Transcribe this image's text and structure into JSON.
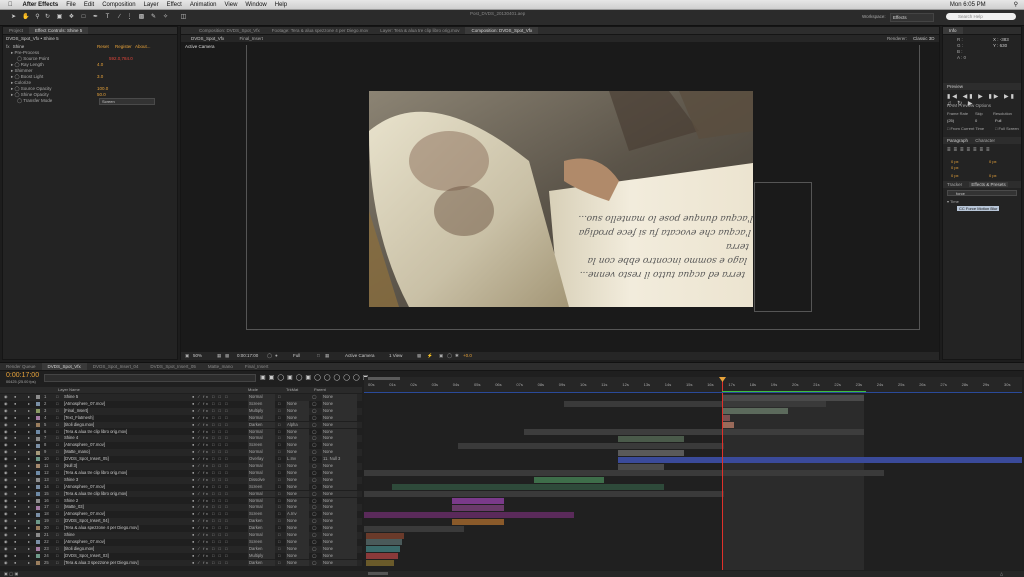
{
  "menubar": {
    "app_name": "After Effects",
    "items": [
      "File",
      "Edit",
      "Composition",
      "Layer",
      "Effect",
      "Animation",
      "View",
      "Window",
      "Help"
    ],
    "clock": "Mon 6:05 PM"
  },
  "toolbar": {
    "workspace_label": "Workspace:",
    "workspace_value": "Effects",
    "search_placeholder": "Search Help",
    "window_title": "Post_DVDS_20130401.aep"
  },
  "left_panel": {
    "tabs": [
      "Project",
      "Effect Controls: Shine 5"
    ],
    "header": "DVDS_Spot_Vfx • Shine 5",
    "effect": {
      "name": "Shine",
      "reset": "Reset",
      "register": "Register",
      "about": "About...",
      "props": [
        {
          "label": "Pre-Process",
          "value": ""
        },
        {
          "label": "Source Point",
          "value": "592.0,784.0"
        },
        {
          "label": "Ray Length",
          "value": "4.0"
        },
        {
          "label": "Shimmer",
          "value": ""
        },
        {
          "label": "Boost Light",
          "value": "3.0"
        },
        {
          "label": "Colorize",
          "value": ""
        },
        {
          "label": "Source Opacity",
          "value": "100.0"
        },
        {
          "label": "Shine Opacity",
          "value": "50.0"
        },
        {
          "label": "Transfer Mode",
          "value": "Screen"
        }
      ]
    }
  },
  "viewer": {
    "tabs": [
      "Composition: DVDS_Spot_Vfx",
      "Footage: Tera & alua spezzone 4 per Diego.mov",
      "Layer: Tera & alua tre clip libro orig.mov",
      "Composition: DVDS_Spot_Vfx"
    ],
    "sub_tabs": [
      "DVDS_Spot_Vfx",
      "Final_Insert"
    ],
    "renderer_label": "Renderer:",
    "renderer_value": "Classic 3D",
    "camera_label": "Active Camera",
    "book_lines": [
      "terra ed acqua tutto il resto venne...",
      "lago e sommo incontro ebbe con la terra",
      "l'acqua che evocata fu si fece prodiga",
      "l'acqua dunque pose lo mantello suo..."
    ],
    "footer": {
      "zoom": "50%",
      "timecode": "0:00:17:00",
      "resolution": "Full",
      "camera": "Active Camera",
      "views": "1 View",
      "exposure": "+0.0"
    }
  },
  "right_panel": {
    "info_tab": "Info",
    "info": {
      "r": "R :",
      "g": "G :",
      "b": "B :",
      "a": "A : 0",
      "x": "X : -383",
      "y": "Y : 630"
    },
    "preview_tab": "Preview",
    "ram_preview": "RAM Preview Options",
    "frame_rate_label": "Frame Rate",
    "skip_label": "Skip",
    "resolution_label": "Resolution",
    "frame_rate": "(25)",
    "skip": "0",
    "resolution": "Full",
    "from_current": "From Current Time",
    "full_screen": "Full Screen",
    "paragraph_tab": "Paragraph",
    "character_tab": "Character",
    "para_values": [
      "0 px",
      "0 px",
      "0 px",
      "0 px",
      "0 px"
    ],
    "tracker_tab": "Tracker",
    "effects_tab": "Effects & Presets",
    "effects_search": "force",
    "effects_group": "Time",
    "effects_item": "CC Force Motion Blur"
  },
  "timeline": {
    "tabs": [
      "Render Queue",
      "DVDS_Spot_Vfx",
      "DVDS_Spot_Insert_04",
      "DVDS_Spot_Insert_05",
      "Matte_mano",
      "Final_Insert"
    ],
    "timecode": "0:00:17:00",
    "frame_info": "00425 (25.00 fps)",
    "col_layer": "Layer Name",
    "col_mode": "Mode",
    "col_trkmat": "TrkMat",
    "col_parent": "Parent",
    "ruler": [
      "00s",
      "01s",
      "02s",
      "03s",
      "04s",
      "05s",
      "06s",
      "07s",
      "08s",
      "09s",
      "10s",
      "11s",
      "12s",
      "13s",
      "14s",
      "15s",
      "16s",
      "17s",
      "18s",
      "19s",
      "20s",
      "21s",
      "22s",
      "23s",
      "24s",
      "25s",
      "26s",
      "27s",
      "28s",
      "29s",
      "30s"
    ],
    "layers": [
      {
        "num": "1",
        "name": "Shine 5",
        "mode": "Normal",
        "trk": "",
        "parent": "None"
      },
      {
        "num": "2",
        "name": "[Atmosphere_07.mov]",
        "mode": "Screen",
        "trk": "None",
        "parent": "None"
      },
      {
        "num": "3",
        "name": "[Final_Insert]",
        "mode": "Multiply",
        "trk": "None",
        "parent": "None"
      },
      {
        "num": "4",
        "name": "[Text_Flatmesh]",
        "mode": "Normal",
        "trk": "None",
        "parent": "None"
      },
      {
        "num": "5",
        "name": "[titoli diego.mov]",
        "mode": "Darken",
        "trk": "Alpha",
        "parent": "None"
      },
      {
        "num": "6",
        "name": "[Tera & alua tre clip libro orig.mov]",
        "mode": "Normal",
        "trk": "None",
        "parent": "None"
      },
      {
        "num": "7",
        "name": "Shine 4",
        "mode": "Normal",
        "trk": "None",
        "parent": "None"
      },
      {
        "num": "8",
        "name": "[Atmosphere_07.mov]",
        "mode": "Screen",
        "trk": "None",
        "parent": "None"
      },
      {
        "num": "9",
        "name": "[Matte_mano]",
        "mode": "Normal",
        "trk": "None",
        "parent": "None"
      },
      {
        "num": "10",
        "name": "[DVDS_Spot_Insert_05]",
        "mode": "Overlay",
        "trk": "L.Inv",
        "parent": "11. Null 3"
      },
      {
        "num": "11",
        "name": "[Null 3]",
        "mode": "Normal",
        "trk": "None",
        "parent": "None"
      },
      {
        "num": "12",
        "name": "[Tera & alua tre clip libro orig.mov]",
        "mode": "Normal",
        "trk": "None",
        "parent": "None"
      },
      {
        "num": "13",
        "name": "Shine 3",
        "mode": "Dissolve",
        "trk": "None",
        "parent": "None"
      },
      {
        "num": "14",
        "name": "[Atmosphere_07.mov]",
        "mode": "Screen",
        "trk": "None",
        "parent": "None"
      },
      {
        "num": "15",
        "name": "[Tera & alua tre clip libro orig.mov]",
        "mode": "Normal",
        "trk": "None",
        "parent": "None"
      },
      {
        "num": "16",
        "name": "Shine 2",
        "mode": "Normal",
        "trk": "None",
        "parent": "None"
      },
      {
        "num": "17",
        "name": "[Matte_03]",
        "mode": "Normal",
        "trk": "None",
        "parent": "None"
      },
      {
        "num": "18",
        "name": "[Atmosphere_07.mov]",
        "mode": "Screen",
        "trk": "A.Inv",
        "parent": "None"
      },
      {
        "num": "19",
        "name": "[DVDS_Spot_Insert_04]",
        "mode": "Darken",
        "trk": "None",
        "parent": "None"
      },
      {
        "num": "20",
        "name": "[Tera & alua spezzone 4 per Diego.mov]",
        "mode": "Darken",
        "trk": "None",
        "parent": "None"
      },
      {
        "num": "21",
        "name": "Shine",
        "mode": "Normal",
        "trk": "None",
        "parent": "None"
      },
      {
        "num": "22",
        "name": "[Atmosphere_07.mov]",
        "mode": "Screen",
        "trk": "None",
        "parent": "None"
      },
      {
        "num": "23",
        "name": "[titoli diego.mov]",
        "mode": "Darken",
        "trk": "None",
        "parent": "None"
      },
      {
        "num": "24",
        "name": "[DVDS_Spot_Insert_03]",
        "mode": "Multiply",
        "trk": "None",
        "parent": "None"
      },
      {
        "num": "25",
        "name": "[Tera & alua 3 spezzone per Diego.mov]",
        "mode": "Darken",
        "trk": "None",
        "parent": "None"
      }
    ],
    "colors": {
      "playhead": "#e0312a",
      "work_area": "#3fbf3f",
      "accent": "#e8a33a"
    }
  }
}
